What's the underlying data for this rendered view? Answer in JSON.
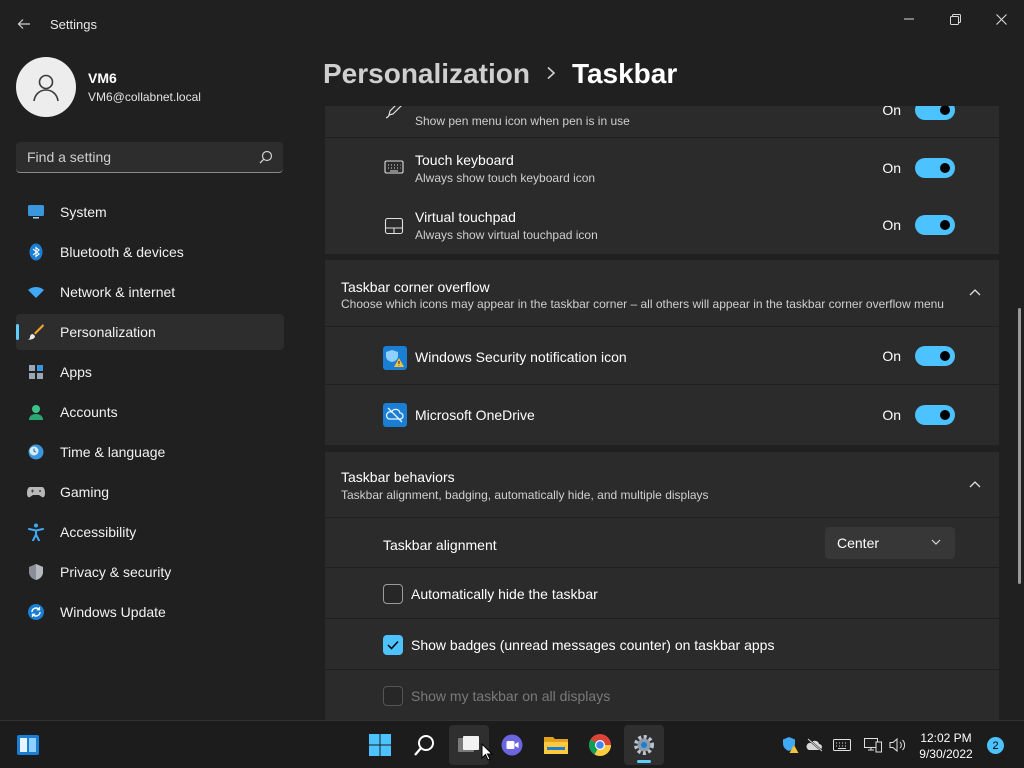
{
  "window": {
    "title": "Settings"
  },
  "profile": {
    "name": "VM6",
    "email": "VM6@collabnet.local"
  },
  "search": {
    "placeholder": "Find a setting"
  },
  "nav": {
    "items": [
      {
        "label": "System",
        "icon": "monitor-icon"
      },
      {
        "label": "Bluetooth & devices",
        "icon": "bluetooth-icon"
      },
      {
        "label": "Network & internet",
        "icon": "wifi-icon"
      },
      {
        "label": "Personalization",
        "icon": "brush-icon",
        "active": true
      },
      {
        "label": "Apps",
        "icon": "apps-icon"
      },
      {
        "label": "Accounts",
        "icon": "person-icon"
      },
      {
        "label": "Time & language",
        "icon": "clock-globe-icon"
      },
      {
        "label": "Gaming",
        "icon": "controller-icon"
      },
      {
        "label": "Accessibility",
        "icon": "accessibility-icon"
      },
      {
        "label": "Privacy & security",
        "icon": "shield-icon"
      },
      {
        "label": "Windows Update",
        "icon": "update-icon"
      }
    ]
  },
  "breadcrumb": {
    "parent": "Personalization",
    "current": "Taskbar"
  },
  "corner_icons": {
    "pen_menu": {
      "subtitle": "Show pen menu icon when pen is in use",
      "state": "On"
    },
    "touch_keyboard": {
      "title": "Touch keyboard",
      "subtitle": "Always show touch keyboard icon",
      "state": "On"
    },
    "virtual_touchpad": {
      "title": "Virtual touchpad",
      "subtitle": "Always show virtual touchpad icon",
      "state": "On"
    }
  },
  "overflow": {
    "title": "Taskbar corner overflow",
    "subtitle": "Choose which icons may appear in the taskbar corner – all others will appear in the taskbar corner overflow menu",
    "items": [
      {
        "label": "Windows Security notification icon",
        "state": "On"
      },
      {
        "label": "Microsoft OneDrive",
        "state": "On"
      }
    ]
  },
  "behaviors": {
    "title": "Taskbar behaviors",
    "subtitle": "Taskbar alignment, badging, automatically hide, and multiple displays",
    "alignment_label": "Taskbar alignment",
    "alignment_value": "Center",
    "auto_hide_label": "Automatically hide the taskbar",
    "badges_label": "Show badges (unread messages counter) on taskbar apps",
    "all_displays_label": "Show my taskbar on all displays"
  },
  "taskbar": {
    "time": "12:02 PM",
    "date": "9/30/2022",
    "notification_count": "2"
  },
  "colors": {
    "accent": "#4cc2ff",
    "background": "#202020",
    "card": "#2b2b2b"
  }
}
